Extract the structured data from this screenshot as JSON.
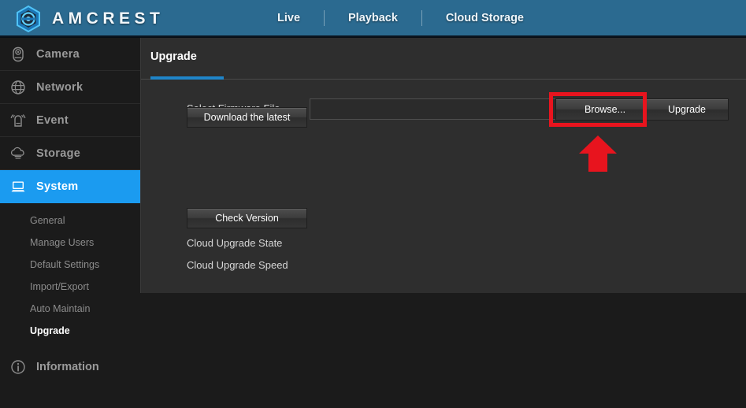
{
  "header": {
    "brand": "AMCREST",
    "logo_icon": "amcrest-hexagon-logo",
    "accent_color": "#1b9bf0",
    "nav": [
      {
        "label": "Live",
        "icon": "live-nav"
      },
      {
        "label": "Playback",
        "icon": "playback-nav"
      },
      {
        "label": "Cloud Storage",
        "icon": "cloud-storage-nav"
      }
    ]
  },
  "sidebar": {
    "items": [
      {
        "label": "Camera",
        "icon": "camera-icon",
        "active": false
      },
      {
        "label": "Network",
        "icon": "globe-icon",
        "active": false
      },
      {
        "label": "Event",
        "icon": "alarm-bell-icon",
        "active": false
      },
      {
        "label": "Storage",
        "icon": "cloud-icon",
        "active": false
      },
      {
        "label": "System",
        "icon": "monitor-icon",
        "active": true
      }
    ],
    "sub_items": [
      {
        "label": "General",
        "active": false
      },
      {
        "label": "Manage Users",
        "active": false
      },
      {
        "label": "Default Settings",
        "active": false
      },
      {
        "label": "Import/Export",
        "active": false
      },
      {
        "label": "Auto Maintain",
        "active": false
      },
      {
        "label": "Upgrade",
        "active": true
      }
    ],
    "information": {
      "label": "Information",
      "icon": "info-circle-icon"
    }
  },
  "content": {
    "tab": "Upgrade",
    "firmware_label": "Select Firmware File",
    "firmware_value": "",
    "firmware_placeholder": "",
    "browse_button": "Browse...",
    "upgrade_button": "Upgrade",
    "download_button": "Download the latest",
    "check_version_button": "Check Version",
    "cloud_upgrade_state_label": "Cloud Upgrade State",
    "cloud_upgrade_state_value": "",
    "cloud_upgrade_speed_label": "Cloud Upgrade Speed",
    "cloud_upgrade_speed_value": ""
  },
  "annotation": {
    "highlight_color": "#e8141e",
    "highlight_target": "Browse...",
    "arrow_icon": "red-up-arrow",
    "box_icon": "red-highlight-box"
  }
}
